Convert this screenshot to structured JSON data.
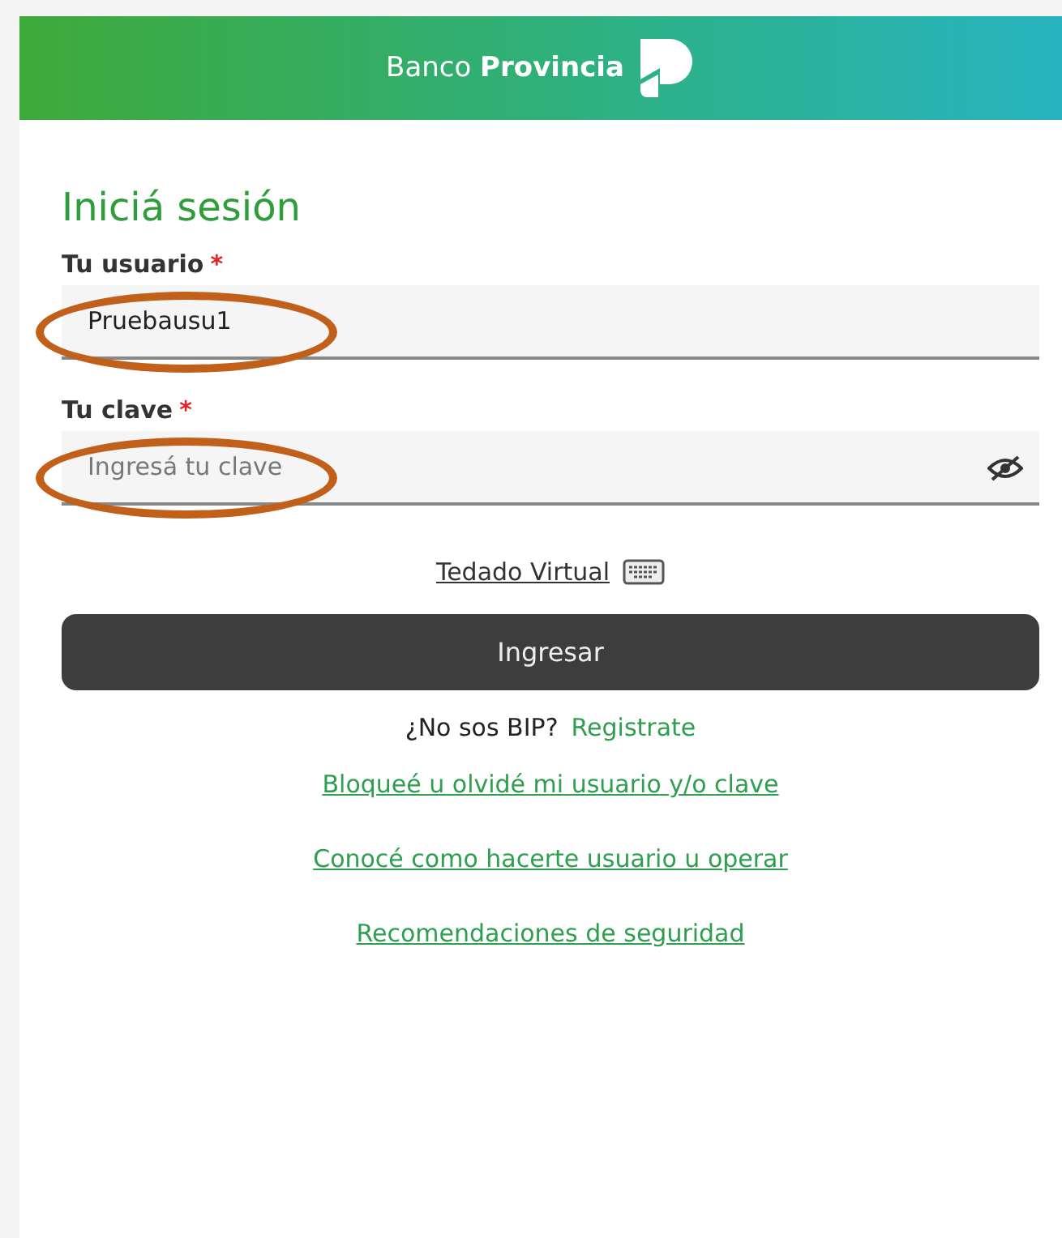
{
  "header": {
    "brand": "Banco **Provincia**"
  },
  "title": "Iniciá sesión",
  "fields": [
    {
      "kind": "text",
      "label": "Tu usuario",
      "required_mark": "*",
      "value": "Pruebausu1",
      "highlighted": true
    },
    {
      "kind": "password",
      "label": "Tu clave",
      "required_mark": "*",
      "placeholder": "Ingresá tu clave",
      "highlighted": true
    }
  ],
  "virtual_keyboard": {
    "label": "Tedado Virtual"
  },
  "submit": {
    "label": "Ingresar"
  },
  "register": {
    "question": "¿No sos BIP?",
    "link": "Registrate"
  },
  "links": [
    "Bloqueé u olvidé mi usuario y/o clave",
    "Conocé como hacerte usuario u operar",
    "Recomendaciones de seguridad"
  ]
}
